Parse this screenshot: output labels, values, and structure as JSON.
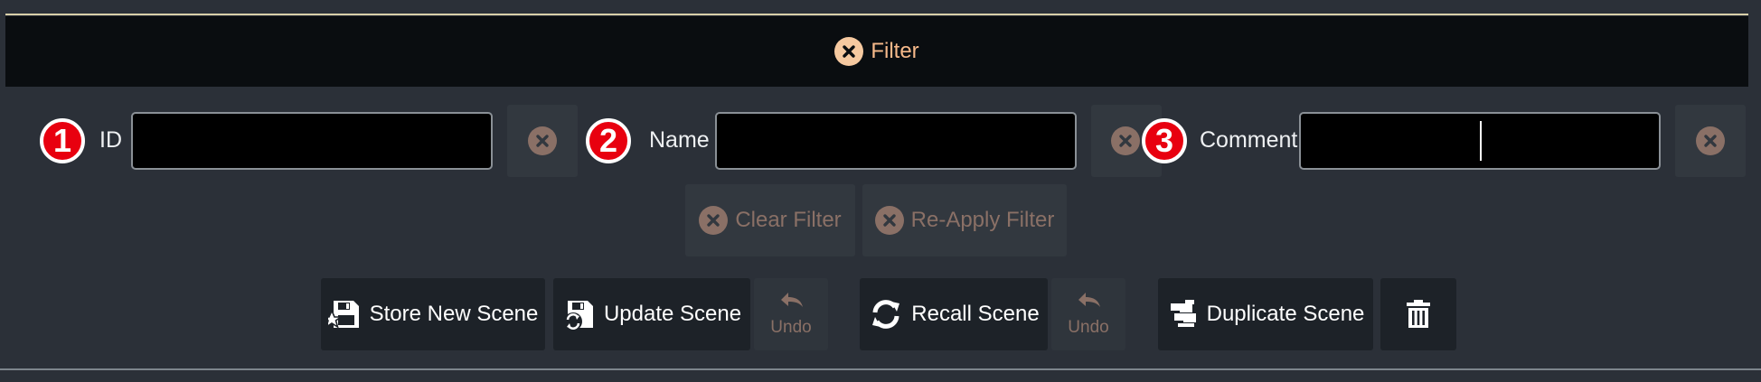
{
  "filter": {
    "toggle_label": "Filter",
    "fields": [
      {
        "badge": "1",
        "label": "ID",
        "value": "",
        "placeholder": ""
      },
      {
        "badge": "2",
        "label": "Name",
        "value": "",
        "placeholder": ""
      },
      {
        "badge": "3",
        "label": "Comment",
        "value": "",
        "placeholder": ""
      }
    ],
    "clear_filter_label": "Clear Filter",
    "reapply_filter_label": "Re-Apply Filter"
  },
  "scene_toolbar": {
    "store_new_label": "Store New Scene",
    "update_label": "Update Scene",
    "update_undo_label": "Undo",
    "recall_label": "Recall Scene",
    "recall_undo_label": "Undo",
    "duplicate_label": "Duplicate Scene"
  },
  "colors": {
    "background": "#2b3038",
    "filter_bar": "#0a0d10",
    "accent_orange": "#f6b98a",
    "disabled_text": "#8a7066",
    "badge_red": "#e8000f"
  }
}
